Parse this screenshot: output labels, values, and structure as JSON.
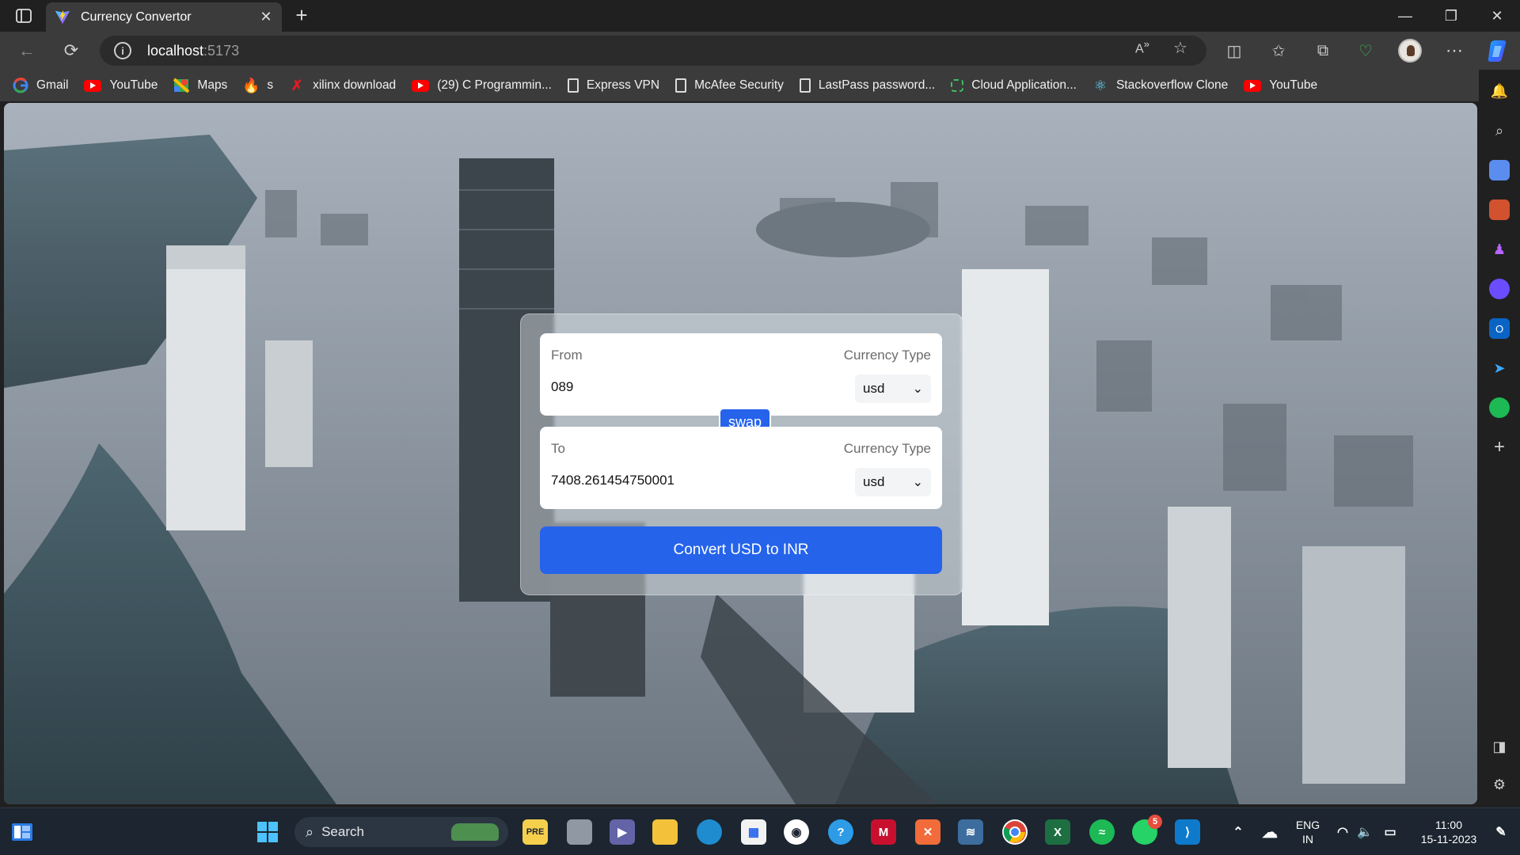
{
  "browser": {
    "tab_title": "Currency Convertor",
    "url_host": "localhost",
    "url_port": ":5173"
  },
  "bookmarks": [
    {
      "label": "Gmail",
      "icon": "google-icon"
    },
    {
      "label": "YouTube",
      "icon": "youtube-icon"
    },
    {
      "label": "Maps",
      "icon": "maps-icon"
    },
    {
      "label": "s",
      "icon": "fire-icon"
    },
    {
      "label": "xilinx download",
      "icon": "xilinx-icon"
    },
    {
      "label": "(29) C Programmin...",
      "icon": "youtube-icon"
    },
    {
      "label": "Express VPN",
      "icon": "document-icon"
    },
    {
      "label": "McAfee Security",
      "icon": "document-icon"
    },
    {
      "label": "LastPass password...",
      "icon": "document-icon"
    },
    {
      "label": "Cloud Application...",
      "icon": "cloud-app-icon"
    },
    {
      "label": "Stackoverflow Clone",
      "icon": "react-icon"
    },
    {
      "label": "YouTube",
      "icon": "youtube-icon"
    }
  ],
  "converter": {
    "from_label": "From",
    "from_amount": "089",
    "from_currency_type_label": "Currency Type",
    "from_currency": "usd",
    "to_label": "To",
    "to_amount": "7408.261454750001",
    "to_currency_type_label": "Currency Type",
    "to_currency": "usd",
    "swap_label": "swap",
    "convert_label": "Convert USD to INR"
  },
  "taskbar": {
    "search_label": "Search",
    "whatsapp_badge": "5",
    "lang_line1": "ENG",
    "lang_line2": "IN",
    "time": "11:00",
    "date": "15-11-2023"
  },
  "colors": {
    "accent": "#2563eb",
    "chrome_dark": "#202020",
    "chrome_mid": "#3b3b3b"
  }
}
